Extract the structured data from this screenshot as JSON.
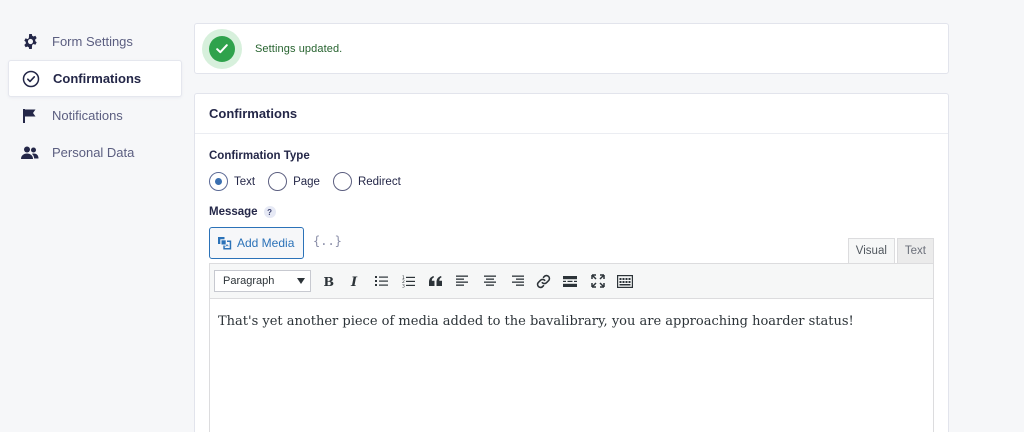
{
  "sidebar": {
    "items": [
      {
        "label": "Form Settings",
        "icon": "gear-icon"
      },
      {
        "label": "Confirmations",
        "icon": "check-circle-icon",
        "active": true
      },
      {
        "label": "Notifications",
        "icon": "flag-icon"
      },
      {
        "label": "Personal Data",
        "icon": "users-icon"
      }
    ]
  },
  "notice": {
    "text": "Settings updated.",
    "icon": "check-icon",
    "color": "#2fa24c"
  },
  "panel": {
    "title": "Confirmations",
    "confirmation_type": {
      "label": "Confirmation Type",
      "options": [
        "Text",
        "Page",
        "Redirect"
      ],
      "selected": "Text"
    },
    "message": {
      "label": "Message",
      "help": "?",
      "add_media": "Add Media",
      "merge_tags": "{..}",
      "tabs": [
        "Visual",
        "Text"
      ],
      "active_tab": "Visual",
      "format": "Paragraph",
      "toolbar": [
        "bold-icon",
        "italic-icon",
        "bullet-list-icon",
        "numbered-list-icon",
        "blockquote-icon",
        "align-left-icon",
        "align-center-icon",
        "align-right-icon",
        "link-icon",
        "read-more-icon",
        "fullscreen-icon",
        "toolbar-toggle-icon"
      ],
      "content": "That's yet another piece of media added to the bavalibrary, you are approaching hoarder status!"
    }
  },
  "colors": {
    "accent": "#2b72b8",
    "success": "#2fa24c",
    "text": "#242748"
  }
}
